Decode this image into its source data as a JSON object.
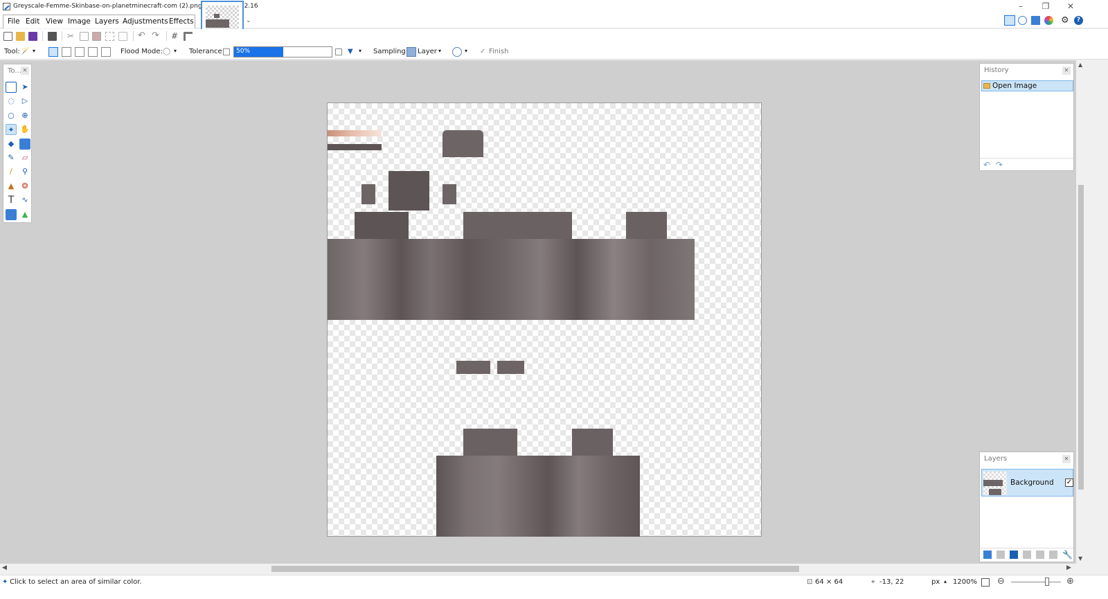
{
  "window": {
    "title": "Greyscale-Femme-Skinbase-on-planetminecraft-com (2).png - paint.net 4.2.16",
    "minimize": "–",
    "restore": "❐",
    "close": "✕"
  },
  "menu": [
    "File",
    "Edit",
    "View",
    "Image",
    "Layers",
    "Adjustments",
    "Effects"
  ],
  "toolbar": {
    "tool_label": "Tool:",
    "flood_mode_label": "Flood Mode:",
    "tolerance_label": "Tolerance:",
    "tolerance_value": "50%",
    "tolerance_percent": 50,
    "sampling_label": "Sampling:",
    "sampling_value": "Layer",
    "finish_label": "Finish"
  },
  "tools_panel": {
    "title": "To..."
  },
  "history_panel": {
    "title": "History",
    "items": [
      "Open Image"
    ]
  },
  "layers_panel": {
    "title": "Layers",
    "layers": [
      {
        "name": "Background",
        "visible": true
      }
    ]
  },
  "status": {
    "hint": "Click to select an area of similar color.",
    "image_size": "64 × 64",
    "cursor_position": "-13, 22",
    "unit": "px",
    "zoom": "1200%"
  },
  "colors": {
    "accent": "#1a73e8",
    "selection": "#cce4f7",
    "canvas_bg": "#cfcfcf",
    "skin_dark": "#5d5456",
    "skin_mid": "#6d6466",
    "skin_light": "#847b7d"
  },
  "icons": [
    "new-icon",
    "open-icon",
    "save-icon",
    "print-icon",
    "cut-icon",
    "copy-icon",
    "paste-icon",
    "crop-icon",
    "deselect-icon",
    "undo-icon",
    "redo-icon",
    "grid-icon",
    "ruler-icon",
    "settings-icon",
    "help-icon"
  ]
}
